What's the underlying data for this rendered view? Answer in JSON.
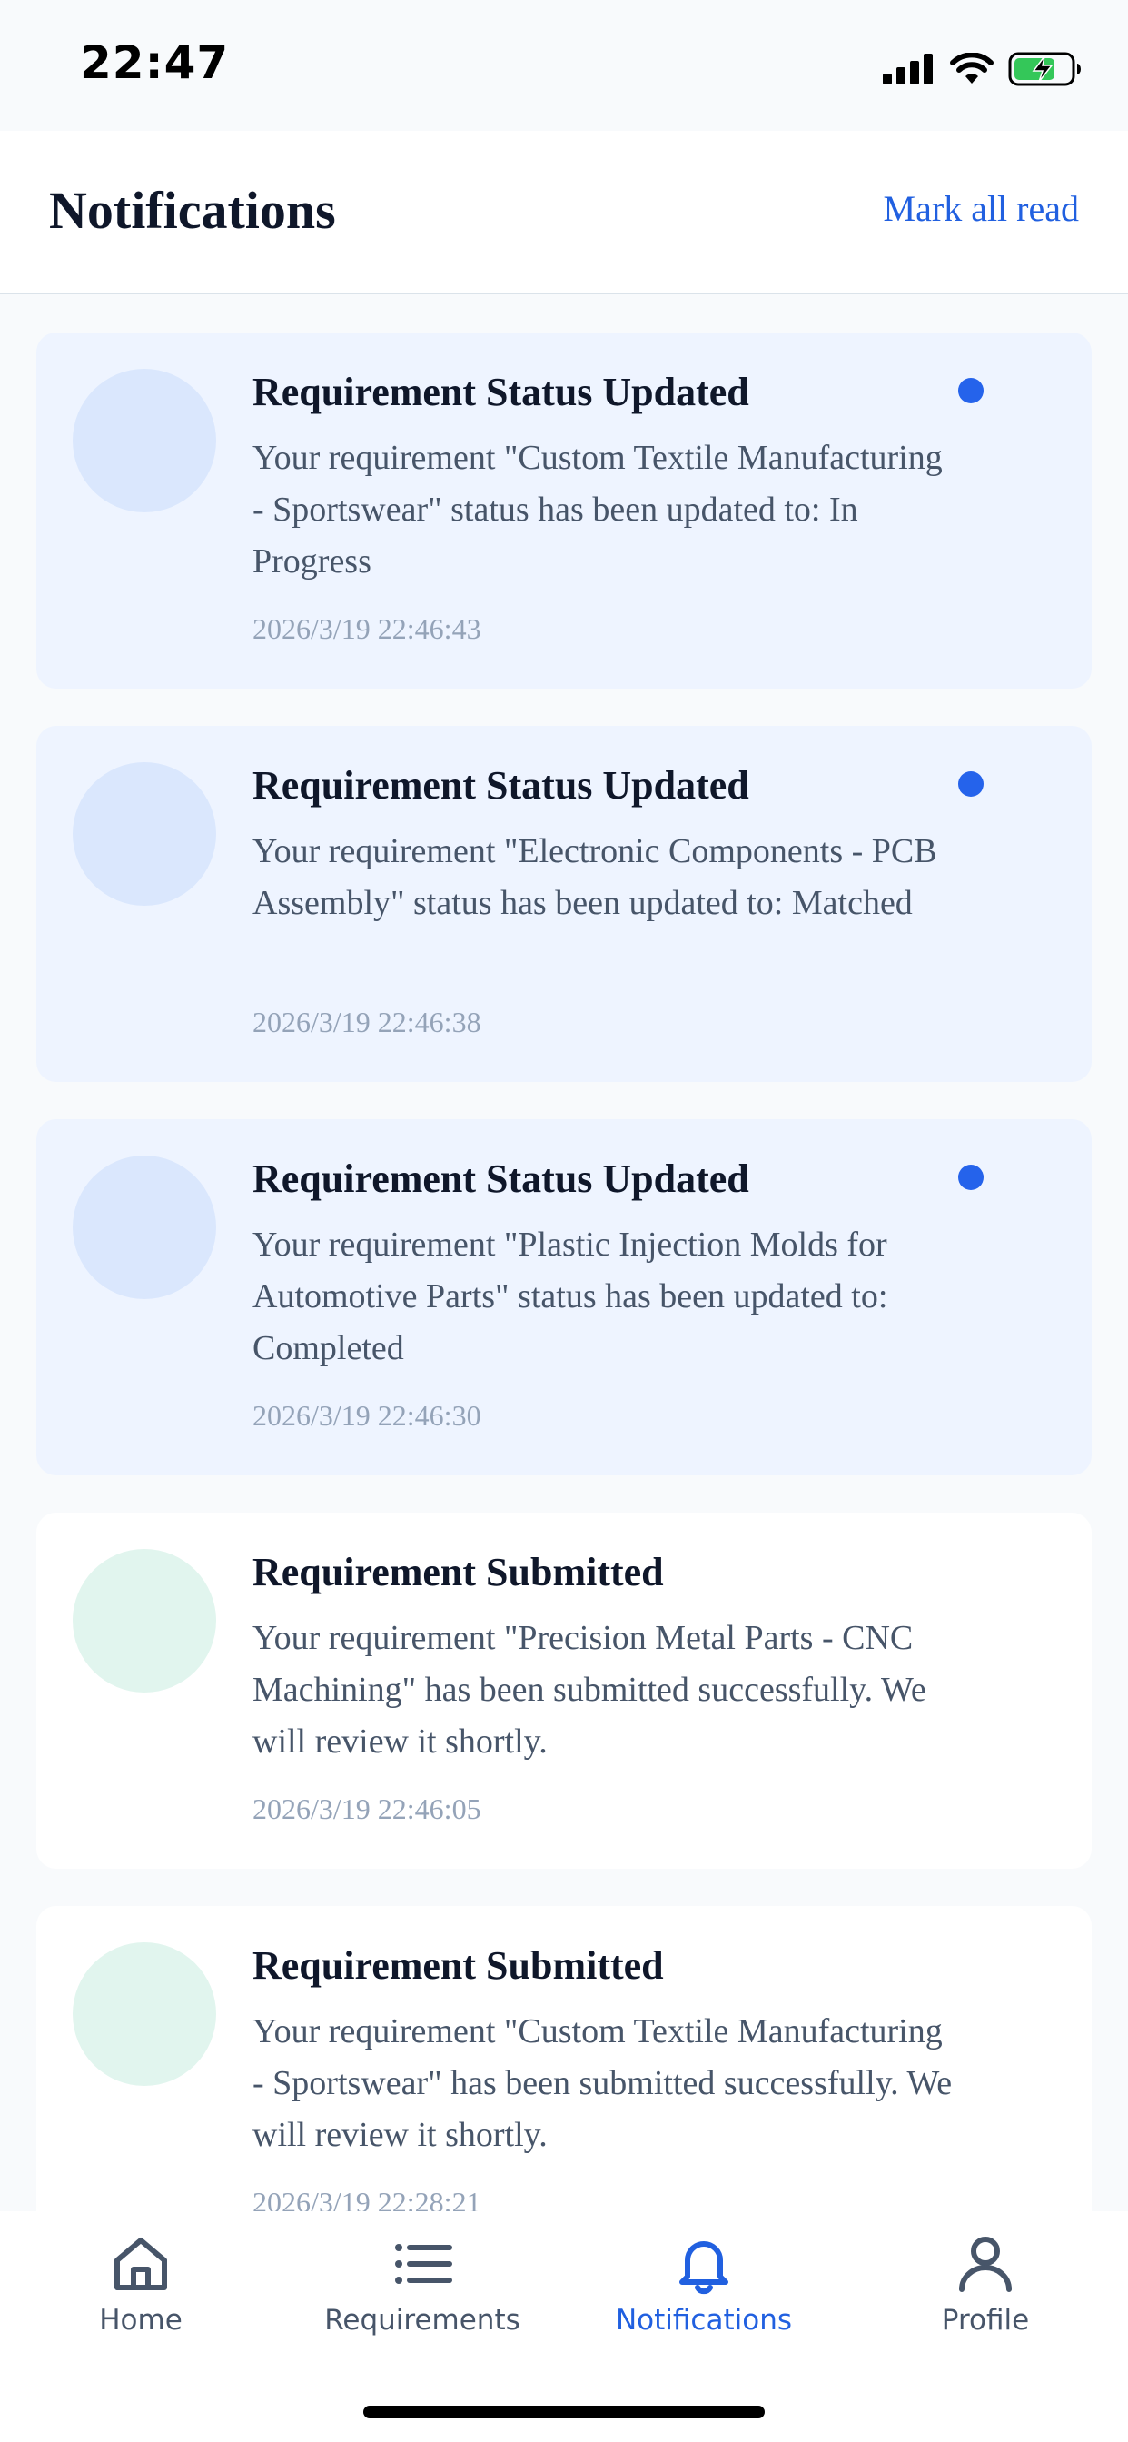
{
  "status_bar": {
    "time": "22:47"
  },
  "header": {
    "title": "Notifications",
    "mark_all_read": "Mark all read"
  },
  "notifications": [
    {
      "title": "Requirement Status Updated",
      "message": "Your requirement \"Custom Textile Manufacturing - Sportswear\" status has been updated to: In Progress",
      "time": "2026/3/19 22:46:43",
      "unread": true
    },
    {
      "title": "Requirement Status Updated",
      "message": "Your requirement \"Electronic Components - PCB Assembly\" status has been updated to: Matched",
      "time": "2026/3/19 22:46:38",
      "unread": true
    },
    {
      "title": "Requirement Status Updated",
      "message": "Your requirement \"Plastic Injection Molds for Automotive Parts\" status has been updated to: Completed",
      "time": "2026/3/19 22:46:30",
      "unread": true
    },
    {
      "title": "Requirement Submitted",
      "message": "Your requirement \"Precision Metal Parts - CNC Machining\" has been submitted successfully. We will review it shortly.",
      "time": "2026/3/19 22:46:05",
      "unread": false
    },
    {
      "title": "Requirement Submitted",
      "message": "Your requirement \"Custom Textile Manufacturing - Sportswear\" has been submitted successfully. We will review it shortly.",
      "time": "2026/3/19 22:28:21",
      "unread": false
    }
  ],
  "tabs": [
    {
      "label": "Home",
      "icon": "home-icon",
      "active": false
    },
    {
      "label": "Requirements",
      "icon": "list-icon",
      "active": false
    },
    {
      "label": "Notifications",
      "icon": "bell-icon",
      "active": true
    },
    {
      "label": "Profile",
      "icon": "user-icon",
      "active": false
    }
  ],
  "colors": {
    "accent": "#2160e0",
    "unread_bg": "#eef4ff",
    "unread_dot": "#2563eb",
    "status_avatar": "#dae7fd",
    "submitted_avatar": "#e1f5ee",
    "battery_green": "#34c759"
  }
}
